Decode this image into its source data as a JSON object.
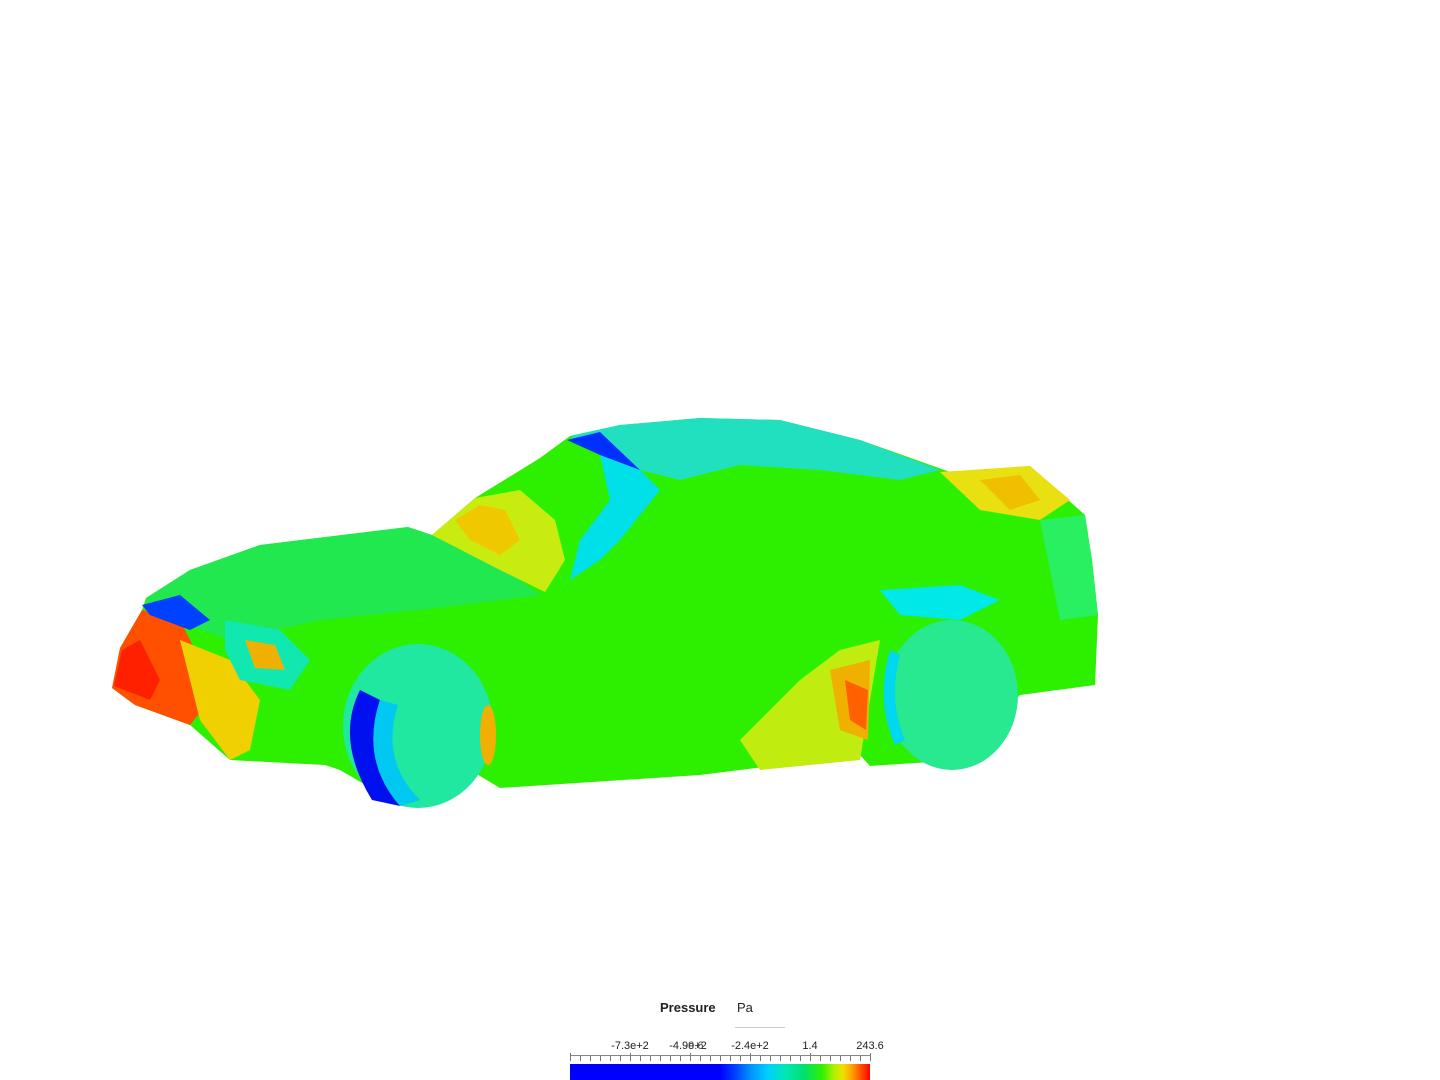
{
  "legend": {
    "title": "Pressure",
    "unit": "Pa",
    "ticks": [
      "-7.3e+2",
      "-4.9e+2",
      "-9.6",
      "-2.4e+2",
      "1.4",
      "243.6"
    ]
  },
  "colors": {
    "min": "#0000ff",
    "max": "#ff0000",
    "mid": "#30f000",
    "background": "#ffffff"
  }
}
